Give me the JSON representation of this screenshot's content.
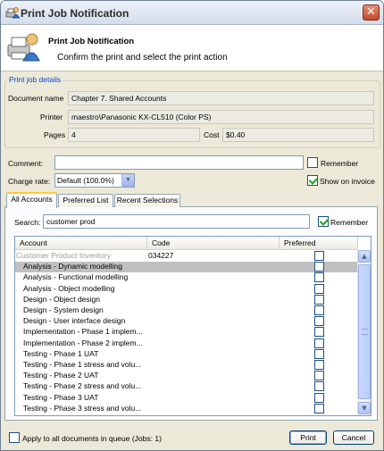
{
  "window": {
    "title": "Print Job Notification"
  },
  "header": {
    "title": "Print Job Notification",
    "subtitle": "Confirm the print and select the print action"
  },
  "details": {
    "legend": "Print job details",
    "document_label": "Document name",
    "document_value": "Chapter 7. Shared Accounts",
    "printer_label": "Printer",
    "printer_value": "maestro\\Panasonic KX-CL510 (Color PS)",
    "pages_label": "Pages",
    "pages_value": "4",
    "cost_label": "Cost",
    "cost_value": "$0.40"
  },
  "comment": {
    "label": "Comment:",
    "value": "",
    "remember_label": "Remember",
    "remember_checked": false
  },
  "charge_rate": {
    "label": "Charge rate:",
    "selected": "Default (100.0%)",
    "show_on_invoice_label": "Show on invoice",
    "show_on_invoice_checked": true
  },
  "tabs": [
    {
      "label": "All Accounts",
      "active": true
    },
    {
      "label": "Preferred List",
      "active": false
    },
    {
      "label": "Recent Selections",
      "active": false
    }
  ],
  "search": {
    "label": "Search:",
    "value": "customer prod",
    "remember_label": "Remember",
    "remember_checked": true
  },
  "table": {
    "columns": [
      "Account",
      "Code",
      "Preferred"
    ],
    "rows": [
      {
        "account": "Customer Product Inventory",
        "code": "034227",
        "kind": "grey",
        "preferred": false
      },
      {
        "account": "Analysis - Dynamic modelling",
        "code": "",
        "kind": "selected",
        "preferred": false
      },
      {
        "account": "Analysis - Functional modelling",
        "code": "",
        "kind": "normal",
        "preferred": false
      },
      {
        "account": "Analysis - Object modelling",
        "code": "",
        "kind": "normal",
        "preferred": false
      },
      {
        "account": "Design - Object design",
        "code": "",
        "kind": "normal",
        "preferred": false
      },
      {
        "account": "Design - System design",
        "code": "",
        "kind": "normal",
        "preferred": false
      },
      {
        "account": "Design - User interface design",
        "code": "",
        "kind": "normal",
        "preferred": false
      },
      {
        "account": "Implementation - Phase 1 implem...",
        "code": "",
        "kind": "normal",
        "preferred": false
      },
      {
        "account": "Implementation - Phase 2 implem...",
        "code": "",
        "kind": "normal",
        "preferred": false
      },
      {
        "account": "Testing - Phase 1 UAT",
        "code": "",
        "kind": "normal",
        "preferred": false
      },
      {
        "account": "Testing - Phase 1 stress and volu...",
        "code": "",
        "kind": "normal",
        "preferred": false
      },
      {
        "account": "Testing - Phase 2 UAT",
        "code": "",
        "kind": "normal",
        "preferred": false
      },
      {
        "account": "Testing - Phase 2 stress and volu...",
        "code": "",
        "kind": "normal",
        "preferred": false
      },
      {
        "account": "Testing - Phase 3 UAT",
        "code": "",
        "kind": "normal",
        "preferred": false
      },
      {
        "account": "Testing - Phase 3 stress and volu...",
        "code": "",
        "kind": "normal",
        "preferred": false
      }
    ]
  },
  "footer": {
    "apply_all_label": "Apply to all documents in queue (Jobs: 1)",
    "apply_all_checked": false,
    "print_label": "Print",
    "cancel_label": "Cancel"
  },
  "icons": {
    "title_icon": "printer-user-icon",
    "header_icon": "printer-user-icon",
    "close": "close-icon",
    "scroll_up": "chevron-up-icon",
    "scroll_down": "chevron-down-icon",
    "dropdown": "chevron-down-icon"
  }
}
